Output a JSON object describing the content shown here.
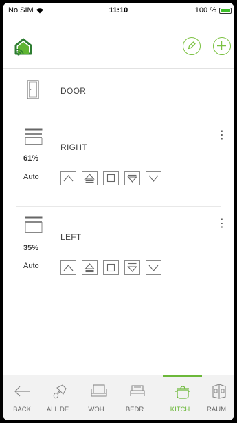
{
  "status_bar": {
    "carrier": "No SIM",
    "time": "11:10",
    "battery_percent": "100 %",
    "battery_level": 1.0
  },
  "header": {
    "logo_icon": "home-wifi-logo-icon",
    "edit_icon": "pencil-icon",
    "add_icon": "plus-icon",
    "accent_color": "#7cc243"
  },
  "devices": [
    {
      "name": "DOOR",
      "icon": "door-icon"
    },
    {
      "name": "RIGHT",
      "icon": "shutter-icon",
      "position": "61%",
      "position_value": 0.61,
      "mode": "Auto"
    },
    {
      "name": "LEFT",
      "icon": "shutter-icon",
      "position": "35%",
      "position_value": 0.35,
      "mode": "Auto"
    }
  ],
  "shutter_controls": [
    "up-arrow-icon",
    "up-to-line-icon",
    "stop-square-icon",
    "down-from-line-icon",
    "down-arrow-icon"
  ],
  "tabs": [
    {
      "label": "BACK",
      "icon": "back-arrow-icon"
    },
    {
      "label": "ALL DE...",
      "icon": "plug-icon"
    },
    {
      "label": "WOH...",
      "icon": "armchair-icon"
    },
    {
      "label": "BEDR...",
      "icon": "bed-icon"
    },
    {
      "label": "KITCH...",
      "icon": "cooking-pot-icon",
      "active": true
    },
    {
      "label": "RAUM...",
      "icon": "room-icon"
    }
  ]
}
